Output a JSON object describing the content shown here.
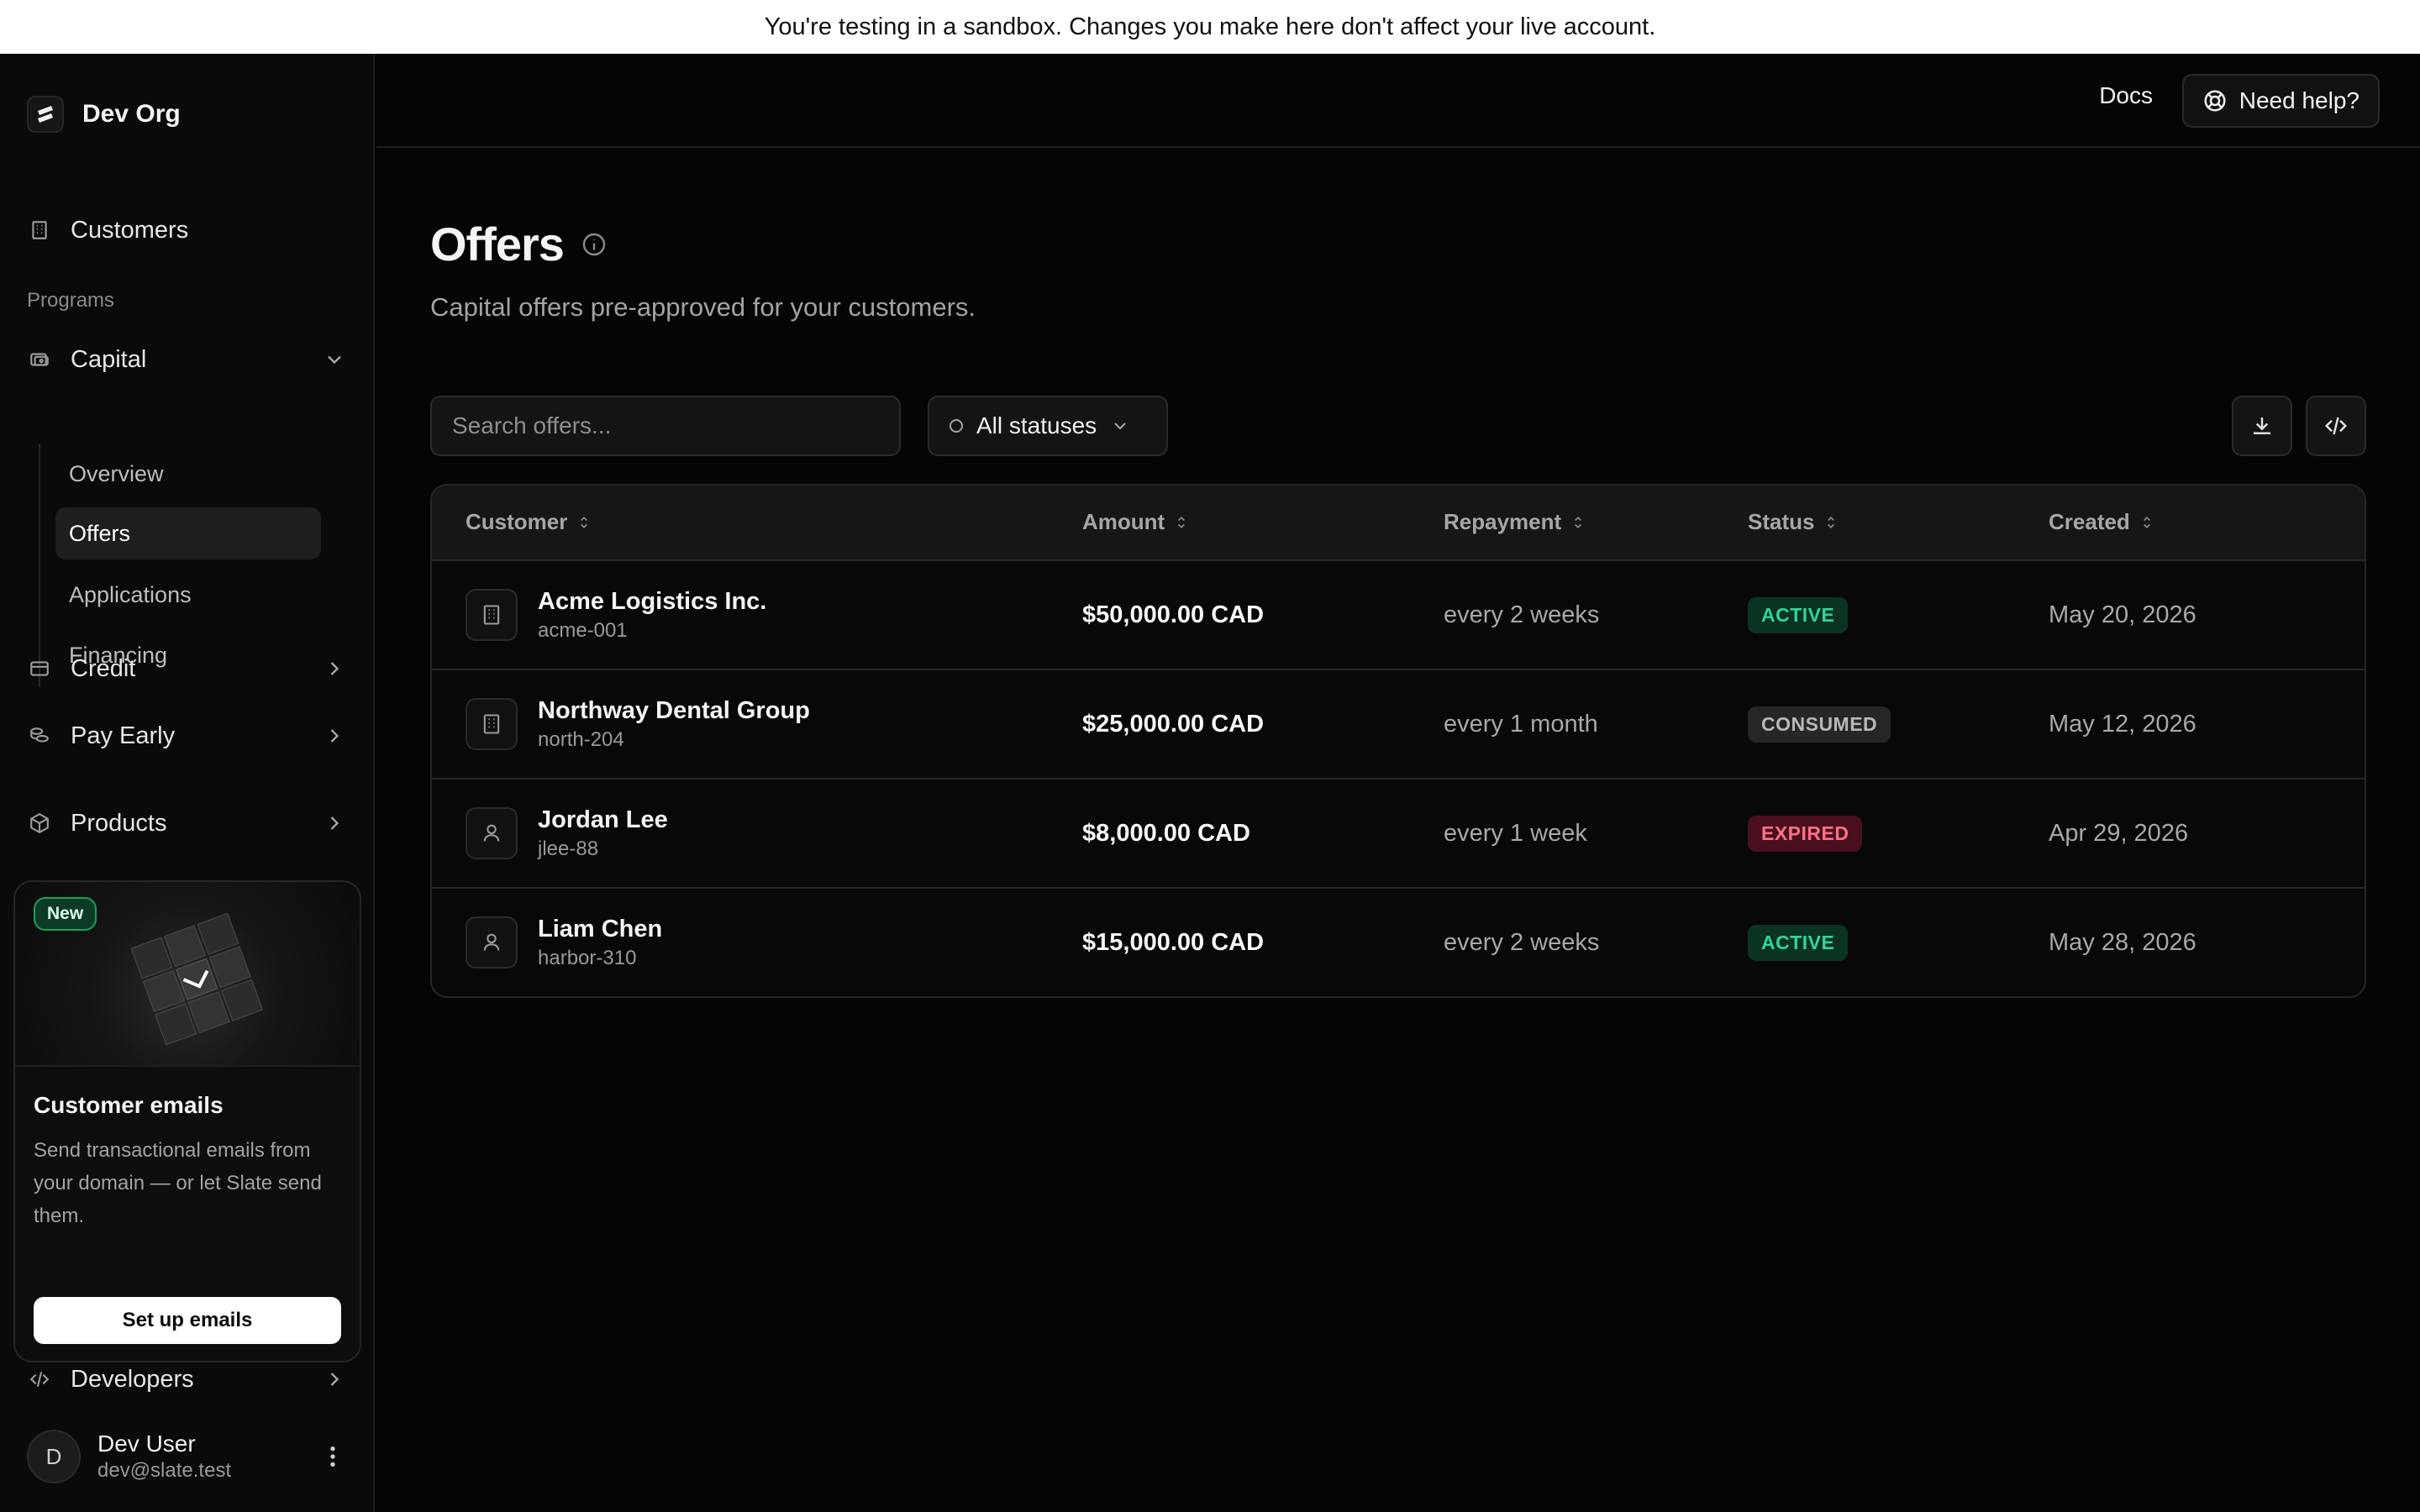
{
  "banner": {
    "text": "You're testing in a sandbox. Changes you make here don't affect your live account."
  },
  "sidebar": {
    "org_name": "Dev Org",
    "customers_label": "Customers",
    "programs_label": "Programs",
    "capital_label": "Capital",
    "capital_subitems": [
      {
        "label": "Overview",
        "active": false
      },
      {
        "label": "Offers",
        "active": true
      },
      {
        "label": "Applications",
        "active": false
      },
      {
        "label": "Financing",
        "active": false
      }
    ],
    "credit_label": "Credit",
    "pay_early_label": "Pay Early",
    "products_label": "Products",
    "developers_label": "Developers",
    "promo": {
      "badge": "New",
      "title": "Customer emails",
      "text": "Send transactional emails from your domain — or let Slate send them.",
      "button": "Set up emails"
    },
    "user": {
      "initial": "D",
      "name": "Dev User",
      "email": "dev@slate.test"
    }
  },
  "topbar": {
    "docs_label": "Docs",
    "help_label": "Need help?"
  },
  "page": {
    "title": "Offers",
    "subtitle": "Capital offers pre-approved for your customers.",
    "search_placeholder": "Search offers...",
    "filter_label": "All statuses"
  },
  "table": {
    "columns": [
      "Customer",
      "Amount",
      "Repayment",
      "Status",
      "Created"
    ],
    "rows": [
      {
        "name": "Acme Logistics Inc.",
        "id": "acme-001",
        "entity_icon": "building-icon",
        "amount": "$50,000.00 CAD",
        "repayment": "every 2 weeks",
        "status": "ACTIVE",
        "created": "May 20, 2026"
      },
      {
        "name": "Northway Dental Group",
        "id": "north-204",
        "entity_icon": "building-icon",
        "amount": "$25,000.00 CAD",
        "repayment": "every 1 month",
        "status": "CONSUMED",
        "created": "May 12, 2026"
      },
      {
        "name": "Jordan Lee",
        "id": "jlee-88",
        "entity_icon": "person-icon",
        "amount": "$8,000.00 CAD",
        "repayment": "every 1 week",
        "status": "EXPIRED",
        "created": "Apr 29, 2026"
      },
      {
        "name": "Liam Chen",
        "id": "harbor-310",
        "entity_icon": "person-icon",
        "amount": "$15,000.00 CAD",
        "repayment": "every 2 weeks",
        "status": "ACTIVE",
        "created": "May 28, 2026"
      }
    ]
  },
  "colors": {
    "status_active": "#34d399",
    "status_consumed": "#b8b8b8",
    "status_expired": "#fb7185",
    "background": "#050505"
  }
}
